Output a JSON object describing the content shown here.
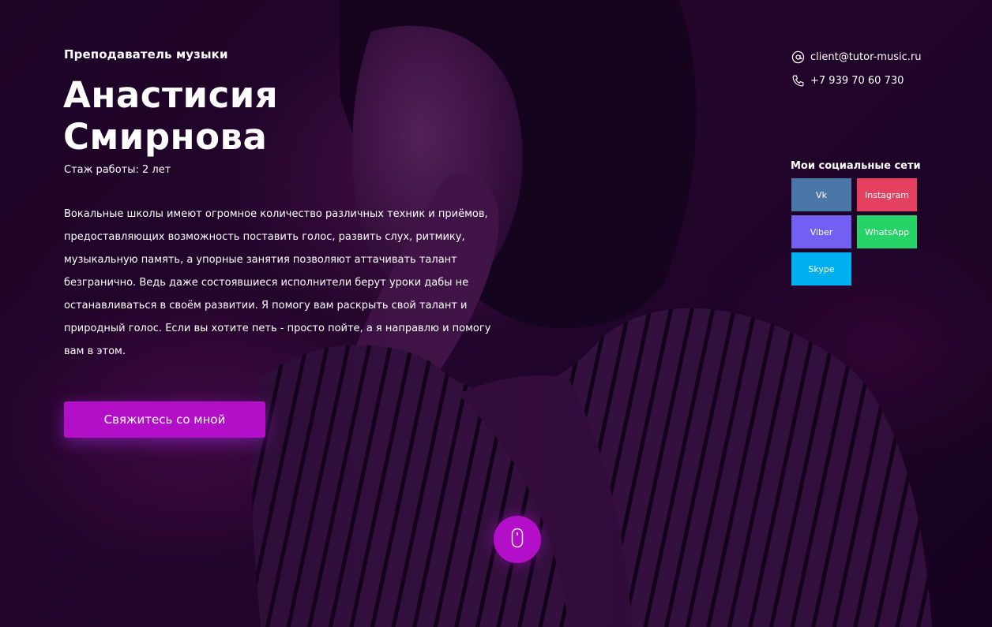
{
  "profile": {
    "role": "Преподаватель музыки",
    "first_name": "Анастисия",
    "last_name": "Смирнова",
    "experience": "Стаж работы: 2 лет",
    "description": "Вокальные школы имеют огромное количество различных техник и приёмов, предоставляющих возможность поставить голос, развить слух, ритмику, музыкальную память, а упорные занятия позволяют аттачивать талант безгранично. Ведь даже состоявшиеся исполнители берут уроки дабы не останавливаться в своём развитии. Я помогу вам раскрыть свой талант и природный голос. Если вы хотите петь - просто пойте, а я направлю и помогу вам в этом."
  },
  "cta": {
    "label": "Свяжитесь со мной"
  },
  "contacts": {
    "email": "client@tutor-music.ru",
    "phone": "+7 939 70 60 730",
    "email_icon": "at-sign-icon",
    "phone_icon": "phone-icon"
  },
  "socials": {
    "title": "Мои социальные сети",
    "items": [
      {
        "label": "Vk",
        "color": "#4a76a8"
      },
      {
        "label": "Instagram",
        "color": "#e4405f"
      },
      {
        "label": "Viber",
        "color": "#7360f2"
      },
      {
        "label": "WhatsApp",
        "color": "#25d366"
      },
      {
        "label": "Skype",
        "color": "#00aff0"
      }
    ]
  },
  "scroll": {
    "icon": "mouse-icon"
  },
  "colors": {
    "accent": "#b40fc8",
    "background": "#1b0325"
  }
}
